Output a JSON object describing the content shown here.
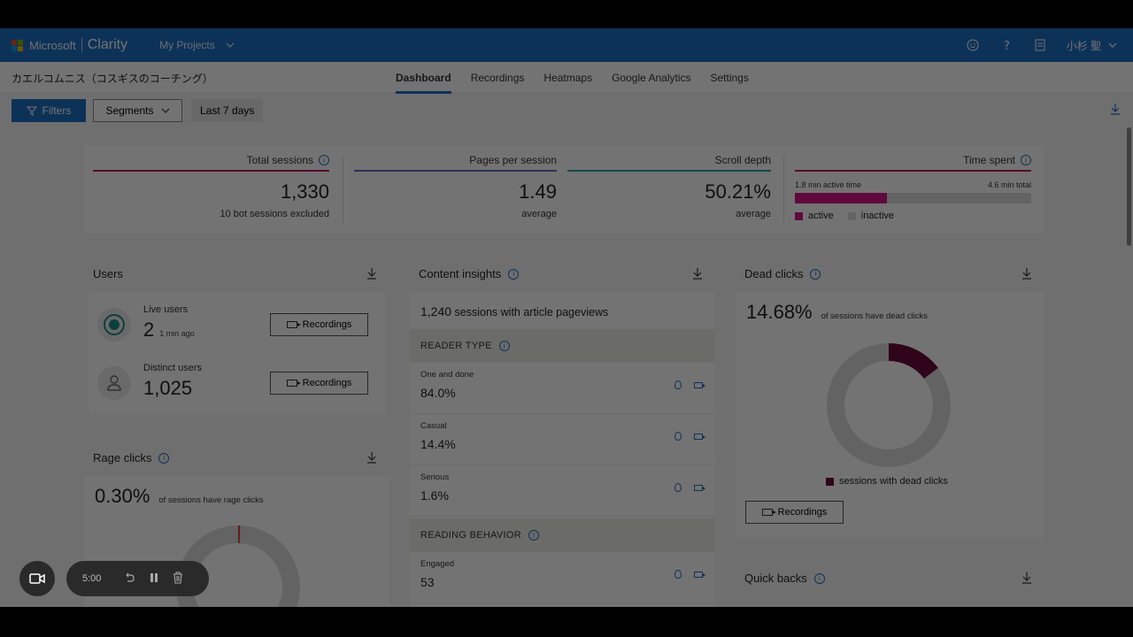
{
  "topbar": {
    "brand_microsoft": "Microsoft",
    "brand_clarity": "Clarity",
    "projects_label": "My Projects",
    "user_name": "小杉 聖",
    "color": "#1e6fc4"
  },
  "project": {
    "name": "カエルコムニス（コスギスのコーチング）"
  },
  "tabs": [
    {
      "label": "Dashboard",
      "active": true
    },
    {
      "label": "Recordings"
    },
    {
      "label": "Heatmaps"
    },
    {
      "label": "Google Analytics"
    },
    {
      "label": "Settings"
    }
  ],
  "filters": {
    "filters_label": "Filters",
    "segments_label": "Segments",
    "range_label": "Last 7 days"
  },
  "metrics": {
    "total_sessions": {
      "label": "Total sessions",
      "value": "1,330",
      "sub": "10 bot sessions excluded"
    },
    "pages_per_session": {
      "label": "Pages per session",
      "value": "1.49",
      "sub": "average"
    },
    "scroll_depth": {
      "label": "Scroll depth",
      "value": "50.21%",
      "sub": "average"
    },
    "time_spent": {
      "label": "Time spent",
      "active_text": "1.8 min active time",
      "total_text": "4.6 min total",
      "active_fraction": 0.39,
      "legend_active": "active",
      "legend_inactive": "inactive",
      "active_color": "#d4148a",
      "inactive_color": "#dcdcdc"
    }
  },
  "users": {
    "title": "Users",
    "live_label": "Live users",
    "live_value": "2",
    "live_ago": "1 min ago",
    "distinct_label": "Distinct users",
    "distinct_value": "1,025",
    "recordings_label": "Recordings"
  },
  "rage": {
    "title": "Rage clicks",
    "pct": "0.30%",
    "desc": "of sessions have rage clicks",
    "fraction": 0.003,
    "color": "#e23b2e"
  },
  "content": {
    "title": "Content insights",
    "headline_num": "1,240",
    "headline_text": "sessions with article pageviews",
    "reader_type_label": "READER TYPE",
    "reader_rows": [
      {
        "label": "One and done",
        "value": "84.0%"
      },
      {
        "label": "Casual",
        "value": "14.4%"
      },
      {
        "label": "Serious",
        "value": "1.6%"
      }
    ],
    "reading_behavior_label": "READING BEHAVIOR",
    "behavior_rows": [
      {
        "label": "Engaged",
        "value": "53"
      }
    ]
  },
  "dead": {
    "title": "Dead clicks",
    "pct": "14.68%",
    "desc": "of sessions have dead clicks",
    "fraction": 0.1468,
    "legend": "sessions with dead clicks",
    "recordings_label": "Recordings",
    "color": "#6b0a3a"
  },
  "quickbacks": {
    "title": "Quick backs"
  },
  "recorder": {
    "time": "5:00"
  }
}
